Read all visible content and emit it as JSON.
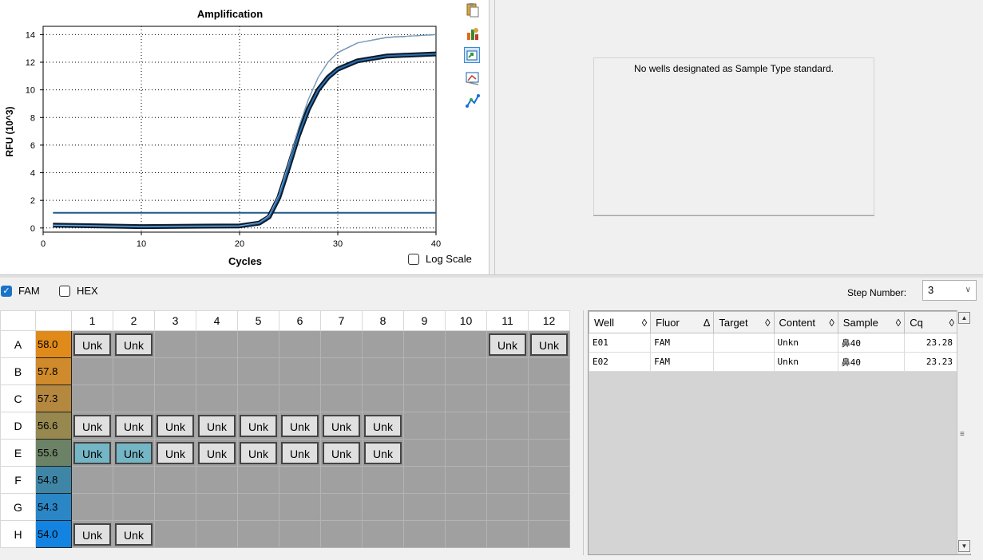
{
  "chart": {
    "title": "Amplification",
    "ylabel": "RFU (10^3)",
    "xlabel": "Cycles",
    "log_scale_label": "Log Scale",
    "x_ticks": [
      "0",
      "10",
      "20",
      "30",
      "40"
    ],
    "y_ticks": [
      "0",
      "2",
      "4",
      "6",
      "8",
      "10",
      "12",
      "14"
    ]
  },
  "chart_data": {
    "type": "line",
    "title": "Amplification",
    "xlabel": "Cycles",
    "ylabel": "RFU (10^3)",
    "xlim": [
      0,
      40
    ],
    "ylim": [
      -0.3,
      14.6
    ],
    "grid": true,
    "log_scale": false,
    "threshold": 1.1,
    "series": [
      {
        "well": "E01",
        "x": [
          1,
          10,
          20,
          22,
          23,
          24,
          25,
          26,
          27,
          28,
          29,
          30,
          32,
          35,
          40
        ],
        "y": [
          0.2,
          0.1,
          0.15,
          0.35,
          0.8,
          2.2,
          4.4,
          6.7,
          8.6,
          10.0,
          10.9,
          11.5,
          12.1,
          12.45,
          12.6
        ]
      },
      {
        "well": "E02",
        "x": [
          1,
          10,
          20,
          22,
          23,
          24,
          25,
          26,
          27,
          28,
          29,
          30,
          32,
          35,
          40
        ],
        "y": [
          0.2,
          0.1,
          0.15,
          0.4,
          0.9,
          2.4,
          4.7,
          7.2,
          9.3,
          10.9,
          12.0,
          12.7,
          13.4,
          13.8,
          14.0
        ]
      }
    ]
  },
  "toolbar": {
    "icons": [
      "clipboard-icon",
      "chart-options-icon",
      "export-icon",
      "zoom-icon",
      "trace-styles-icon"
    ]
  },
  "standard_curve": {
    "message": "No wells designated as Sample Type standard."
  },
  "fluor_filter": {
    "fam_label": "FAM",
    "fam_checked": true,
    "hex_label": "HEX",
    "hex_checked": false
  },
  "step": {
    "label": "Step Number:",
    "value": "3"
  },
  "plate": {
    "columns": [
      "1",
      "2",
      "3",
      "4",
      "5",
      "6",
      "7",
      "8",
      "9",
      "10",
      "11",
      "12"
    ],
    "rows": [
      {
        "label": "A",
        "temp": "58.0",
        "temp_color": "#e08a1a",
        "wells": [
          "Unk",
          "Unk",
          "",
          "",
          "",
          "",
          "",
          "",
          "",
          "",
          "Unk",
          "Unk"
        ]
      },
      {
        "label": "B",
        "temp": "57.8",
        "temp_color": "#cf8a2c",
        "wells": [
          "",
          "",
          "",
          "",
          "",
          "",
          "",
          "",
          "",
          "",
          "",
          ""
        ]
      },
      {
        "label": "C",
        "temp": "57.3",
        "temp_color": "#b5883f",
        "wells": [
          "",
          "",
          "",
          "",
          "",
          "",
          "",
          "",
          "",
          "",
          "",
          ""
        ]
      },
      {
        "label": "D",
        "temp": "56.6",
        "temp_color": "#96884e",
        "wells": [
          "Unk",
          "Unk",
          "Unk",
          "Unk",
          "Unk",
          "Unk",
          "Unk",
          "Unk",
          "",
          "",
          "",
          ""
        ]
      },
      {
        "label": "E",
        "temp": "55.6",
        "temp_color": "#6c8266",
        "wells": [
          "Unk",
          "Unk",
          "Unk",
          "Unk",
          "Unk",
          "Unk",
          "Unk",
          "Unk",
          "",
          "",
          "",
          ""
        ]
      },
      {
        "label": "F",
        "temp": "54.8",
        "temp_color": "#3f86a6",
        "wells": [
          "",
          "",
          "",
          "",
          "",
          "",
          "",
          "",
          "",
          "",
          "",
          ""
        ]
      },
      {
        "label": "G",
        "temp": "54.3",
        "temp_color": "#2a86c4",
        "wells": [
          "",
          "",
          "",
          "",
          "",
          "",
          "",
          "",
          "",
          "",
          "",
          ""
        ]
      },
      {
        "label": "H",
        "temp": "54.0",
        "temp_color": "#1283e0",
        "wells": [
          "Unk",
          "Unk",
          "",
          "",
          "",
          "",
          "",
          "",
          "",
          "",
          "",
          ""
        ]
      }
    ]
  },
  "results": {
    "headers": [
      "Well",
      "Fluor",
      "Target",
      "Content",
      "Sample",
      "Cq"
    ],
    "sort_glyphs": [
      "◊",
      "Δ",
      "◊",
      "◊",
      "◊",
      "◊"
    ],
    "rows": [
      {
        "well": "E01",
        "fluor": "FAM",
        "target": "",
        "content": "Unkn",
        "sample": "鼻40",
        "cq": "23.28"
      },
      {
        "well": "E02",
        "fluor": "FAM",
        "target": "",
        "content": "Unkn",
        "sample": "鼻40",
        "cq": "23.23"
      }
    ]
  }
}
